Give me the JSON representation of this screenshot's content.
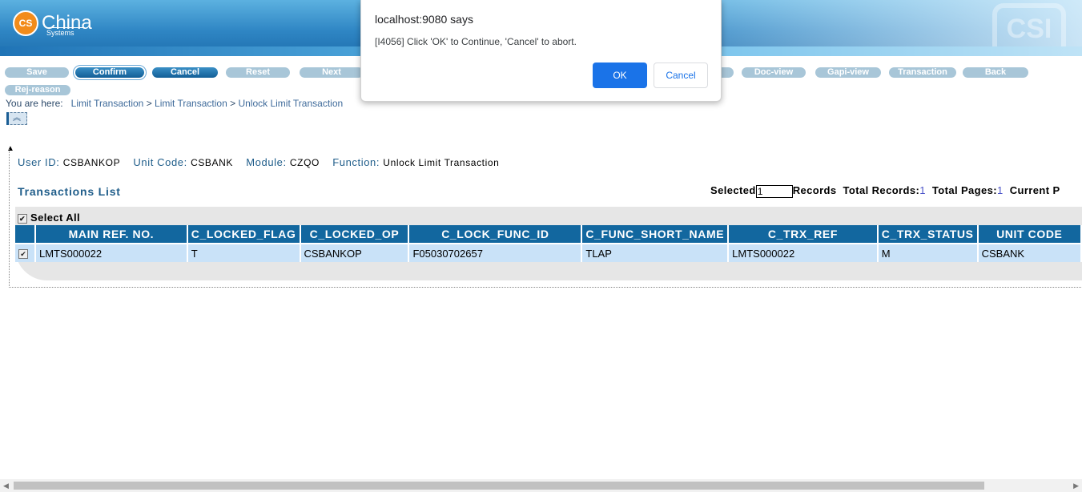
{
  "header": {
    "logo_badge": "CS",
    "logo_text": "China",
    "logo_sub": "Systems",
    "watermark": "CSI"
  },
  "toolbar": {
    "buttons": [
      "Save",
      "Confirm",
      "Cancel",
      "Reset",
      "Next",
      "Doc-view",
      "Gapi-view",
      "Transaction",
      "Back",
      "Rej-reason"
    ]
  },
  "breadcrumb": {
    "prefix": "You are here:",
    "items": [
      "Limit Transaction",
      "Limit Transaction",
      "Unlock Limit Transaction"
    ],
    "separator": ">"
  },
  "info": {
    "user_id_label": "User ID:",
    "user_id": "CSBANKOP",
    "unit_code_label": "Unit Code:",
    "unit_code": "CSBANK",
    "module_label": "Module:",
    "module": "CZQO",
    "function_label": "Function:",
    "function": "Unlock Limit Transaction"
  },
  "list": {
    "title": "Transactions List",
    "selected_label": "Selected",
    "selected_value": "1",
    "records_label": "Records",
    "total_records_label": "Total Records:",
    "total_records": "1",
    "total_pages_label": "Total Pages:",
    "total_pages": "1",
    "current_label": "Current P",
    "select_all": "Select All",
    "columns": [
      "MAIN REF. NO.",
      "C_LOCKED_FLAG",
      "C_LOCKED_OP",
      "C_LOCK_FUNC_ID",
      "C_FUNC_SHORT_NAME",
      "C_TRX_REF",
      "C_TRX_STATUS",
      "UNIT CODE"
    ],
    "rows": [
      [
        "LMTS000022",
        "T",
        "CSBANKOP",
        "F05030702657",
        "TLAP",
        "LMTS000022",
        "M",
        "CSBANK"
      ]
    ]
  },
  "dialog": {
    "title": "localhost:9080 says",
    "message": "[I4056] Click 'OK' to Continue, 'Cancel' to abort.",
    "ok": "OK",
    "cancel": "Cancel"
  },
  "colors": {
    "accent": "#12679f",
    "dialog_primary": "#1a73e8",
    "row_bg": "#c9e2f8"
  }
}
